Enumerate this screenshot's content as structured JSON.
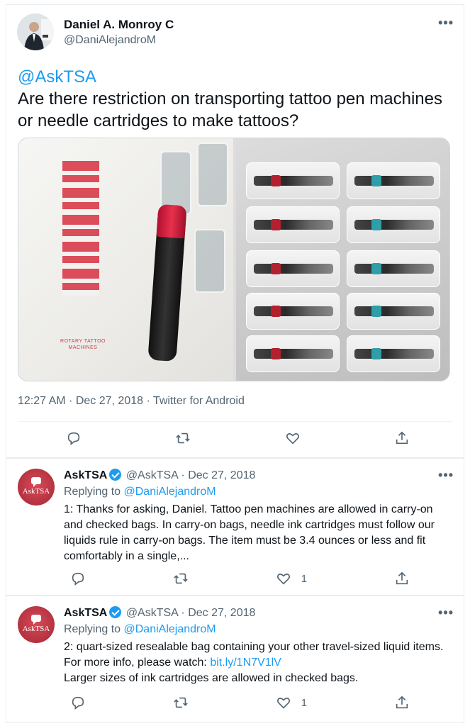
{
  "main_tweet": {
    "author_name": "Daniel A. Monroy C",
    "author_handle": "@DaniAlejandroM",
    "mention": "@AskTSA",
    "text": "Are there restriction on transporting tattoo pen machines or needle cartridges to make tattoos?",
    "media_caption": "ROTARY TATTOO MACHINES",
    "timestamp": "12:27 AM · Dec 27, 2018 · Twitter for Android",
    "more_icon": "more-horizontal-icon"
  },
  "replies": [
    {
      "author_name": "AskTSA",
      "handle": "@AskTSA",
      "date": "Dec 27, 2018",
      "replying_prefix": "Replying to",
      "replying_to": "@DaniAlejandroM",
      "body": "1: Thanks for asking, Daniel. Tattoo pen machines are allowed in carry-on and checked bags. In carry-on bags, needle ink cartridges must follow our liquids rule in carry-on bags. The item must be 3.4 ounces or less and fit comfortably in a single,...",
      "like_count": "1"
    },
    {
      "author_name": "AskTSA",
      "handle": "@AskTSA",
      "date": "Dec 27, 2018",
      "replying_prefix": "Replying to",
      "replying_to": "@DaniAlejandroM",
      "body_line1": "2: quart-sized resealable bag containing your other travel-sized liquid items. For more info, please watch:",
      "link": "bit.ly/1N7V1lV",
      "body_line2": "Larger sizes of ink cartridges are allowed in checked bags.",
      "like_count": "1"
    }
  ],
  "avatar_text": "AskTSA",
  "colors": {
    "link": "#1d9bf0",
    "secondary_text": "#536471",
    "primary_text": "#0f1419",
    "tsa_avatar": "#c43a48"
  }
}
